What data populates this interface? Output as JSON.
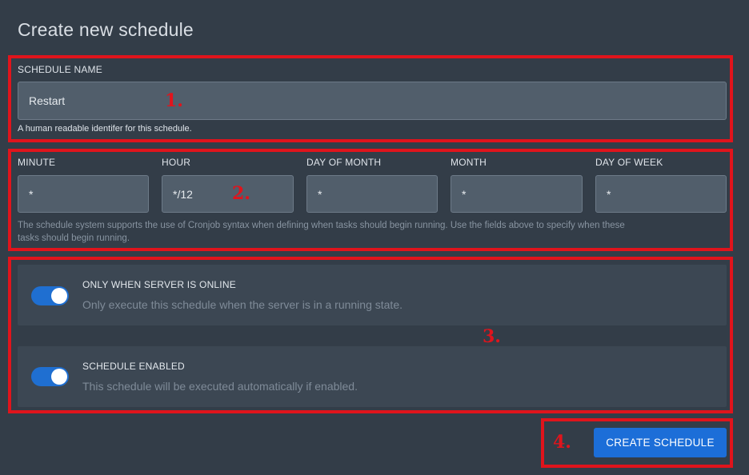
{
  "page": {
    "title": "Create new schedule"
  },
  "annotations": [
    "1.",
    "2.",
    "3.",
    "4."
  ],
  "schedule_name": {
    "label": "SCHEDULE NAME",
    "value": "Restart",
    "help": "A human readable identifer for this schedule."
  },
  "cron": {
    "fields": [
      {
        "label": "MINUTE",
        "value": "*"
      },
      {
        "label": "HOUR",
        "value": "*/12"
      },
      {
        "label": "DAY OF MONTH",
        "value": "*"
      },
      {
        "label": "MONTH",
        "value": "*"
      },
      {
        "label": "DAY OF WEEK",
        "value": "*"
      }
    ],
    "help_line1": "The schedule system supports the use of Cronjob syntax when defining when tasks should begin running. Use the fields above to specify when these",
    "help_line2": "tasks should begin running."
  },
  "toggles": [
    {
      "title": "ONLY WHEN SERVER IS ONLINE",
      "description": "Only execute this schedule when the server is in a running state.",
      "enabled": true
    },
    {
      "title": "SCHEDULE ENABLED",
      "description": "This schedule will be executed automatically if enabled.",
      "enabled": true
    }
  ],
  "submit": {
    "label": "CREATE SCHEDULE"
  },
  "colors": {
    "background": "#333d48",
    "accent": "#1c6ed8",
    "annotation": "#e0141c"
  }
}
